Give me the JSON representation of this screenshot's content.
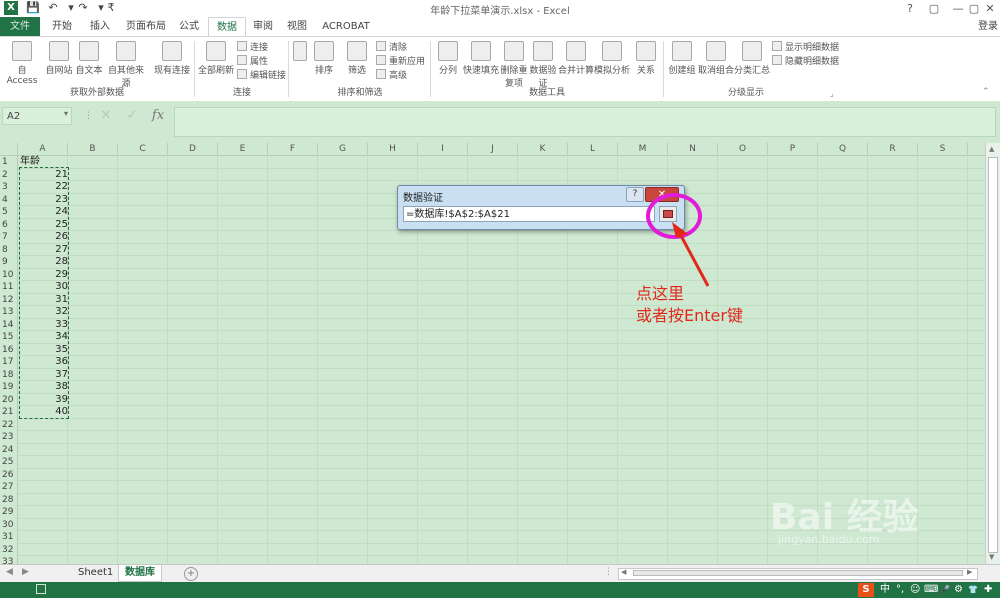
{
  "window": {
    "title": "年龄下拉菜单演示.xlsx - Excel",
    "login_label": "登录",
    "controls": [
      "?",
      "▢",
      "—",
      "▢",
      "✕"
    ]
  },
  "quick_access": [
    "save-icon",
    "undo-icon",
    "redo-icon",
    "customize-icon"
  ],
  "tabs": [
    {
      "label": "文件"
    },
    {
      "label": "开始"
    },
    {
      "label": "插入"
    },
    {
      "label": "页面布局"
    },
    {
      "label": "公式"
    },
    {
      "label": "数据",
      "active": true
    },
    {
      "label": "审阅"
    },
    {
      "label": "视图"
    },
    {
      "label": "ACROBAT"
    }
  ],
  "ribbon": {
    "groups": [
      {
        "label": "获取外部数据",
        "buttons": [
          "自 Access",
          "自网站",
          "自文本",
          "自其他来源",
          "现有连接"
        ]
      },
      {
        "label": "连接",
        "buttons": [
          "全部刷新"
        ],
        "small": [
          "连接",
          "属性",
          "编辑链接"
        ]
      },
      {
        "label": "排序和筛选",
        "buttons": [
          "排序",
          "筛选"
        ],
        "small": [
          "清除",
          "重新应用",
          "高级"
        ]
      },
      {
        "label": "数据工具",
        "buttons": [
          "分列",
          "快速填充",
          "删除重复项",
          "数据验证",
          "合并计算",
          "模拟分析",
          "关系"
        ]
      },
      {
        "label": "分级显示",
        "buttons": [
          "创建组",
          "取消组合",
          "分类汇总"
        ],
        "small": [
          "显示明细数据",
          "隐藏明细数据"
        ]
      }
    ]
  },
  "formula_bar": {
    "name_box": "A2",
    "fx_label": "fx",
    "cancel_icon": "✕",
    "enter_icon": "✓"
  },
  "sheet": {
    "columns": [
      "A",
      "B",
      "C",
      "D",
      "E",
      "F",
      "G",
      "H",
      "I",
      "J",
      "K",
      "L",
      "M",
      "N",
      "O",
      "P",
      "Q",
      "R",
      "S"
    ],
    "rows": [
      "1",
      "2",
      "3",
      "4",
      "5",
      "6",
      "7",
      "8",
      "9",
      "10",
      "11",
      "12",
      "13",
      "14",
      "15",
      "16",
      "17",
      "18",
      "19",
      "20",
      "21",
      "22",
      "23",
      "24",
      "25",
      "26",
      "27",
      "28",
      "29",
      "30",
      "31",
      "32",
      "33"
    ],
    "column_a": [
      "年龄",
      "21",
      "22",
      "23",
      "24",
      "25",
      "26",
      "27",
      "28",
      "29",
      "30",
      "31",
      "32",
      "33",
      "34",
      "35",
      "36",
      "37",
      "38",
      "39",
      "40"
    ]
  },
  "dialog": {
    "title": "数据验证",
    "help": "?",
    "close": "✕",
    "reference": "=数据库!$A$2:$A$21"
  },
  "annotation": {
    "line1": "点这里",
    "line2": "或者按Enter键",
    "color": "#e0281b",
    "circle_color": "#e21bd9"
  },
  "sheet_tabs": [
    {
      "label": "Sheet1"
    },
    {
      "label": "数据库",
      "active": true
    }
  ],
  "status_bar": {
    "system_tray": [
      "S",
      "中",
      "°,",
      "☺",
      "⌨",
      "🎤",
      "⚙",
      "👕",
      "✚"
    ]
  },
  "watermark": {
    "brand": "Bai 经验",
    "url": "jingyan.baidu.com"
  },
  "colors": {
    "excel_green": "#217346",
    "grid_bg": "#cfe8d1"
  }
}
